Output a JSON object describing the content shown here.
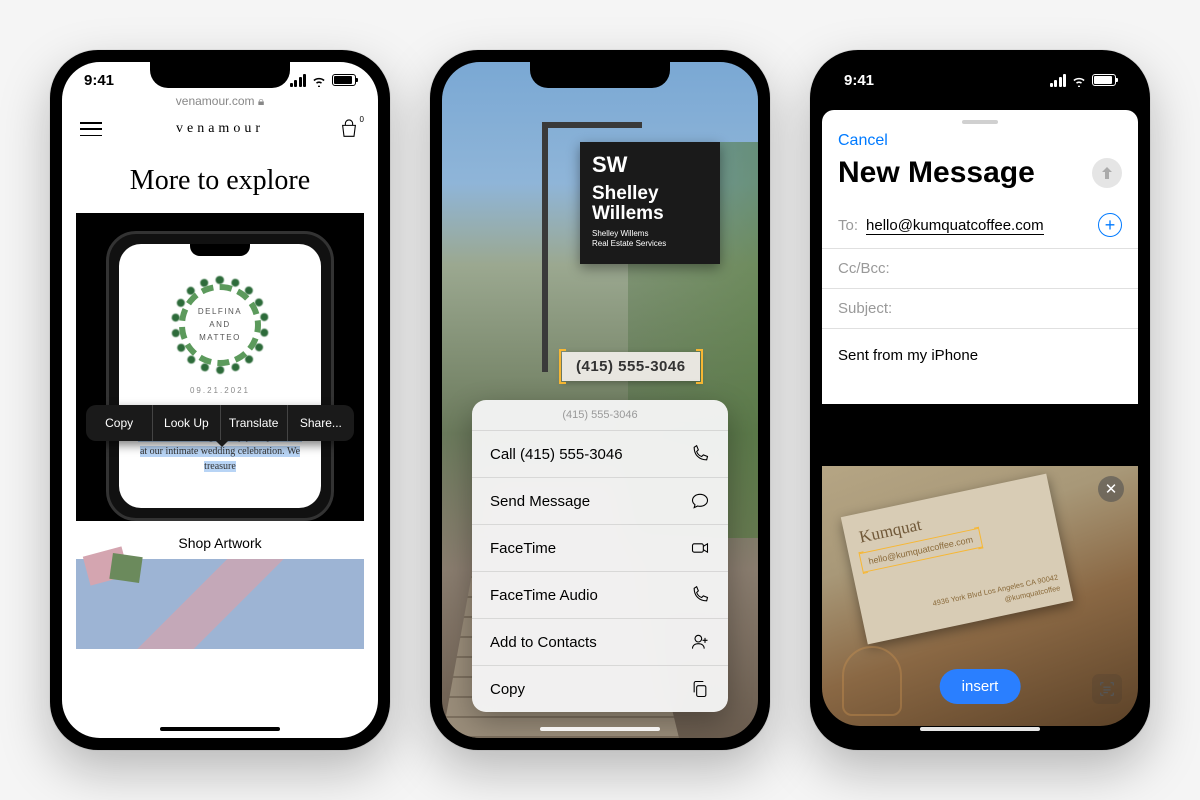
{
  "status": {
    "time": "9:41"
  },
  "phone1": {
    "url": "venamour.com",
    "brand": "venamour",
    "cart_count": "0",
    "heading": "More to explore",
    "invite_names": "DELFINA\nAND\nMATTEO",
    "invite_date": "09.21.2021",
    "popover": {
      "copy": "Copy",
      "lookup": "Look Up",
      "translate": "Translate",
      "share": "Share..."
    },
    "selected_text": "We would be delighted by your presence at our intimate wedding celebration. We treasure",
    "caption": "Shop Artwork"
  },
  "phone2": {
    "sign_initials": "SW",
    "sign_name": "Shelley Willems",
    "sign_sub1": "Shelley Willems",
    "sign_sub2": "Real Estate Services",
    "phone_number": "(415) 555-3046",
    "menu_header": "(415) 555-3046",
    "menu": {
      "call": "Call (415) 555-3046",
      "message": "Send Message",
      "facetime": "FaceTime",
      "ft_audio": "FaceTime Audio",
      "add_contact": "Add to Contacts",
      "copy": "Copy"
    }
  },
  "phone3": {
    "cancel": "Cancel",
    "title": "New Message",
    "to_label": "To:",
    "to_value": "hello@kumquatcoffee.com",
    "cc_label": "Cc/Bcc:",
    "subject_label": "Subject:",
    "body": "Sent from my iPhone",
    "card_name": "Kumquat",
    "card_email": "hello@kumquatcoffee.com",
    "card_addr1": "4936 York Blvd Los Angeles CA 90042",
    "card_addr2": "@kumquatcoffee",
    "insert": "insert"
  }
}
